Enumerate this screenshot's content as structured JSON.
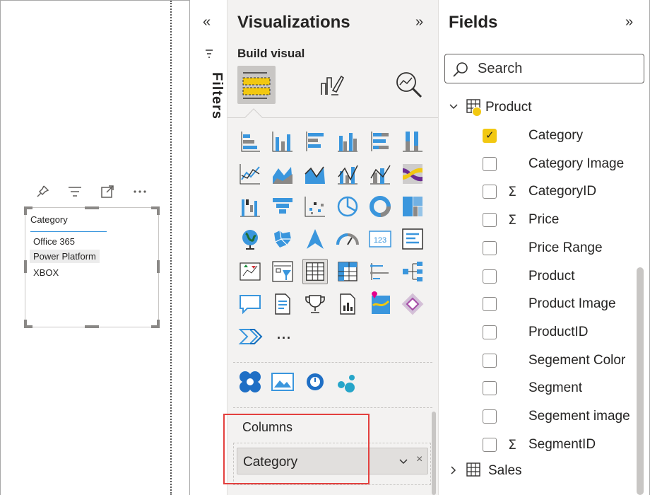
{
  "slicer": {
    "header": "Category",
    "items": [
      "Office 365",
      "Power Platform",
      "XBOX"
    ],
    "selected_index": 1
  },
  "filters": {
    "label": "Filters",
    "collapse_glyph": "«"
  },
  "visualizations": {
    "title": "Visualizations",
    "expand_glyph": "»",
    "build_label": "Build visual",
    "more_glyph": "···",
    "columns_label": "Columns",
    "column_field": "Category",
    "pill_chevron": "⌵",
    "pill_close": "×",
    "highlight_color": "#e3403e"
  },
  "fields": {
    "title": "Fields",
    "expand_glyph": "»",
    "search_placeholder": "Search",
    "tables": [
      {
        "name": "Product",
        "expanded": true
      },
      {
        "name": "Sales",
        "expanded": false
      }
    ],
    "product_fields": [
      {
        "name": "Category",
        "checked": true,
        "sigma": false
      },
      {
        "name": "Category Image",
        "checked": false,
        "sigma": false
      },
      {
        "name": "CategoryID",
        "checked": false,
        "sigma": true
      },
      {
        "name": "Price",
        "checked": false,
        "sigma": true
      },
      {
        "name": "Price Range",
        "checked": false,
        "sigma": false
      },
      {
        "name": "Product",
        "checked": false,
        "sigma": false
      },
      {
        "name": "Product Image",
        "checked": false,
        "sigma": false
      },
      {
        "name": "ProductID",
        "checked": false,
        "sigma": false
      },
      {
        "name": "Segement Color",
        "checked": false,
        "sigma": false
      },
      {
        "name": "Segment",
        "checked": false,
        "sigma": false
      },
      {
        "name": "Segement image",
        "checked": false,
        "sigma": false
      },
      {
        "name": "SegmentID",
        "checked": false,
        "sigma": true
      }
    ],
    "sigma_glyph": "Σ",
    "chevron_down": "⌄",
    "chevron_right": "›",
    "accent": "#f2c811"
  }
}
